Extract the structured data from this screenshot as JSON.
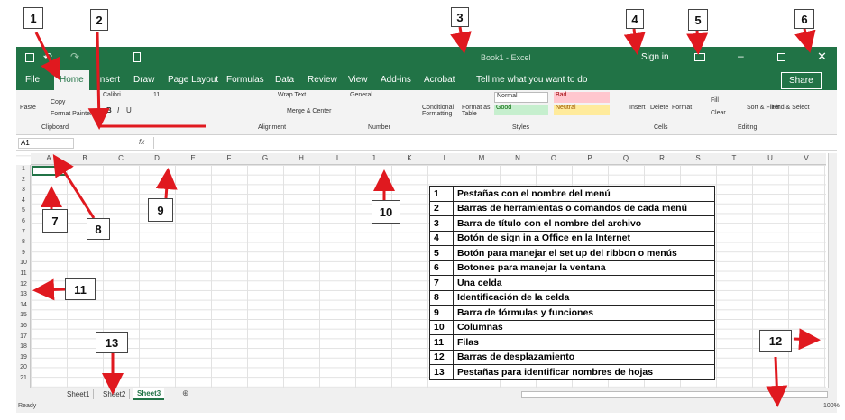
{
  "window": {
    "title": "Book1 - Excel",
    "sign_in": "Sign in",
    "share": "Share",
    "tell_me": "Tell me what you want to do"
  },
  "tabs": [
    "File",
    "Home",
    "Insert",
    "Draw",
    "Page Layout",
    "Formulas",
    "Data",
    "Review",
    "View",
    "Add-ins",
    "Acrobat"
  ],
  "ribbon": {
    "paste": "Paste",
    "copy": "Copy",
    "format_painter": "Format Painter",
    "clipboard": "Clipboard",
    "font_name": "Calibri",
    "font_size": "11",
    "wrap_text": "Wrap Text",
    "merge_center": "Merge & Center",
    "alignment": "Alignment",
    "number_format": "General",
    "number": "Number",
    "conditional_formatting": "Conditional Formatting",
    "format_as_table": "Format as Table",
    "styles": "Styles",
    "normal": "Normal",
    "bad": "Bad",
    "good": "Good",
    "neutral": "Neutral",
    "insert": "Insert",
    "delete": "Delete",
    "format": "Format",
    "cells": "Cells",
    "fill": "Fill",
    "clear": "Clear",
    "sort_filter": "Sort & Filter",
    "find_select": "Find & Select",
    "editing": "Editing"
  },
  "formula_bar": {
    "name_box": "A1",
    "fx": "fx"
  },
  "columns": [
    "A",
    "B",
    "C",
    "D",
    "E",
    "F",
    "G",
    "H",
    "I",
    "J",
    "K",
    "L",
    "M",
    "N",
    "O",
    "P",
    "Q",
    "R",
    "S",
    "T",
    "U",
    "V"
  ],
  "rows": [
    "1",
    "2",
    "3",
    "4",
    "5",
    "6",
    "7",
    "8",
    "9",
    "10",
    "11",
    "12",
    "13",
    "14",
    "15",
    "16",
    "17",
    "18",
    "19",
    "20",
    "21"
  ],
  "sheets": [
    "Sheet1",
    "Sheet2",
    "Sheet3"
  ],
  "status": {
    "ready": "Ready",
    "zoom": "100%"
  },
  "callouts": [
    "1",
    "2",
    "3",
    "4",
    "5",
    "6",
    "7",
    "8",
    "9",
    "10",
    "11",
    "12",
    "13"
  ],
  "legend": [
    {
      "n": "1",
      "d": "Pestañas con el nombre del menú"
    },
    {
      "n": "2",
      "d": "Barras de herramientas o comandos de cada menú"
    },
    {
      "n": "3",
      "d": "Barra de título con el nombre del archivo"
    },
    {
      "n": "4",
      "d": "Botón de sign in a Office en la Internet"
    },
    {
      "n": "5",
      "d": "Botón para manejar el set up del ribbon o menús"
    },
    {
      "n": "6",
      "d": "Botones para manejar la ventana"
    },
    {
      "n": "7",
      "d": "Una celda"
    },
    {
      "n": "8",
      "d": "Identificación de la celda"
    },
    {
      "n": "9",
      "d": "Barra de fórmulas y funciones"
    },
    {
      "n": "10",
      "d": "Columnas"
    },
    {
      "n": "11",
      "d": "Filas"
    },
    {
      "n": "12",
      "d": "Barras de desplazamiento"
    },
    {
      "n": "13",
      "d": "Pestañas para identificar nombres de hojas"
    }
  ],
  "colors": {
    "excel_green": "#217346",
    "arrow_red": "#e0191f",
    "good_bg": "#c6efce",
    "bad_bg": "#ffc7ce",
    "neutral_bg": "#ffeb9c"
  }
}
